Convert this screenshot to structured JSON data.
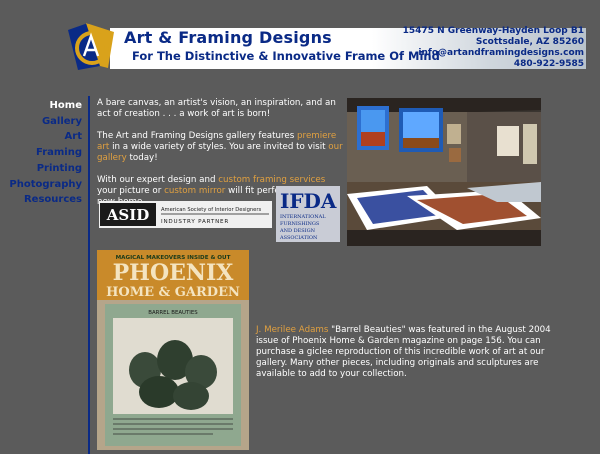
{
  "brand": {
    "name": "Art & Framing Designs",
    "tagline": "For The Distinctive & Innovative Frame Of Mind",
    "address": "15475 N Greenway-Hayden Loop B1",
    "city": "Scottsdale, AZ 85260",
    "email": "info@artandframingdesigns.com",
    "phone": "480-922-9585"
  },
  "nav": {
    "items": [
      "Home",
      "Gallery",
      "Art",
      "Framing",
      "Printing",
      "Photography",
      "Resources"
    ],
    "active": "Home"
  },
  "intro": {
    "p1": "A bare canvas, an artist's vision, an inspiration, and an act of creation . . . a work of art is born!",
    "p2_a": "The Art and Framing Designs gallery features ",
    "p2_link1": "premiere art",
    "p2_b": " in a wide variety of styles.  You are invited to visit ",
    "p2_link2": "our gallery",
    "p2_c": " today!",
    "p3_a": "With our expert design and ",
    "p3_link1": "custom framing services",
    "p3_b": " your picture or ",
    "p3_link2": "custom mirror",
    "p3_c": " will fit perfectly into its new home."
  },
  "badges": {
    "asid_abbr": "ASID",
    "asid_line1": "American Society of Interior Designers",
    "asid_line2": "INDUSTRY PARTNER",
    "ifda_abbr": "IFDA",
    "ifda_line1": "INTERNATIONAL",
    "ifda_line2": "FURNISHINGS",
    "ifda_line3": "AND DESIGN",
    "ifda_line4": "ASSOCIATION"
  },
  "magazine": {
    "kicker": "MAGICAL MAKEOVERS INSIDE & OUT",
    "title1": "PHOENIX",
    "title2": "HOME & GARDEN",
    "article": "BARREL BEAUTIES"
  },
  "feature": {
    "artist_link": "J. Merilee Adams",
    "text": " \"Barrel Beauties\" was featured in the August 2004 issue of Phoenix Home & Garden magazine on page 156. You can purchase a giclee reproduction of this incredible work of art at our gallery. Many other pieces, including originals and sculptures are available to add to your collection."
  },
  "colors": {
    "background": "#5b5b5b",
    "brand_blue": "#0a2a86",
    "link_orange": "#e0a040",
    "logo_gold": "#d9a21b"
  }
}
